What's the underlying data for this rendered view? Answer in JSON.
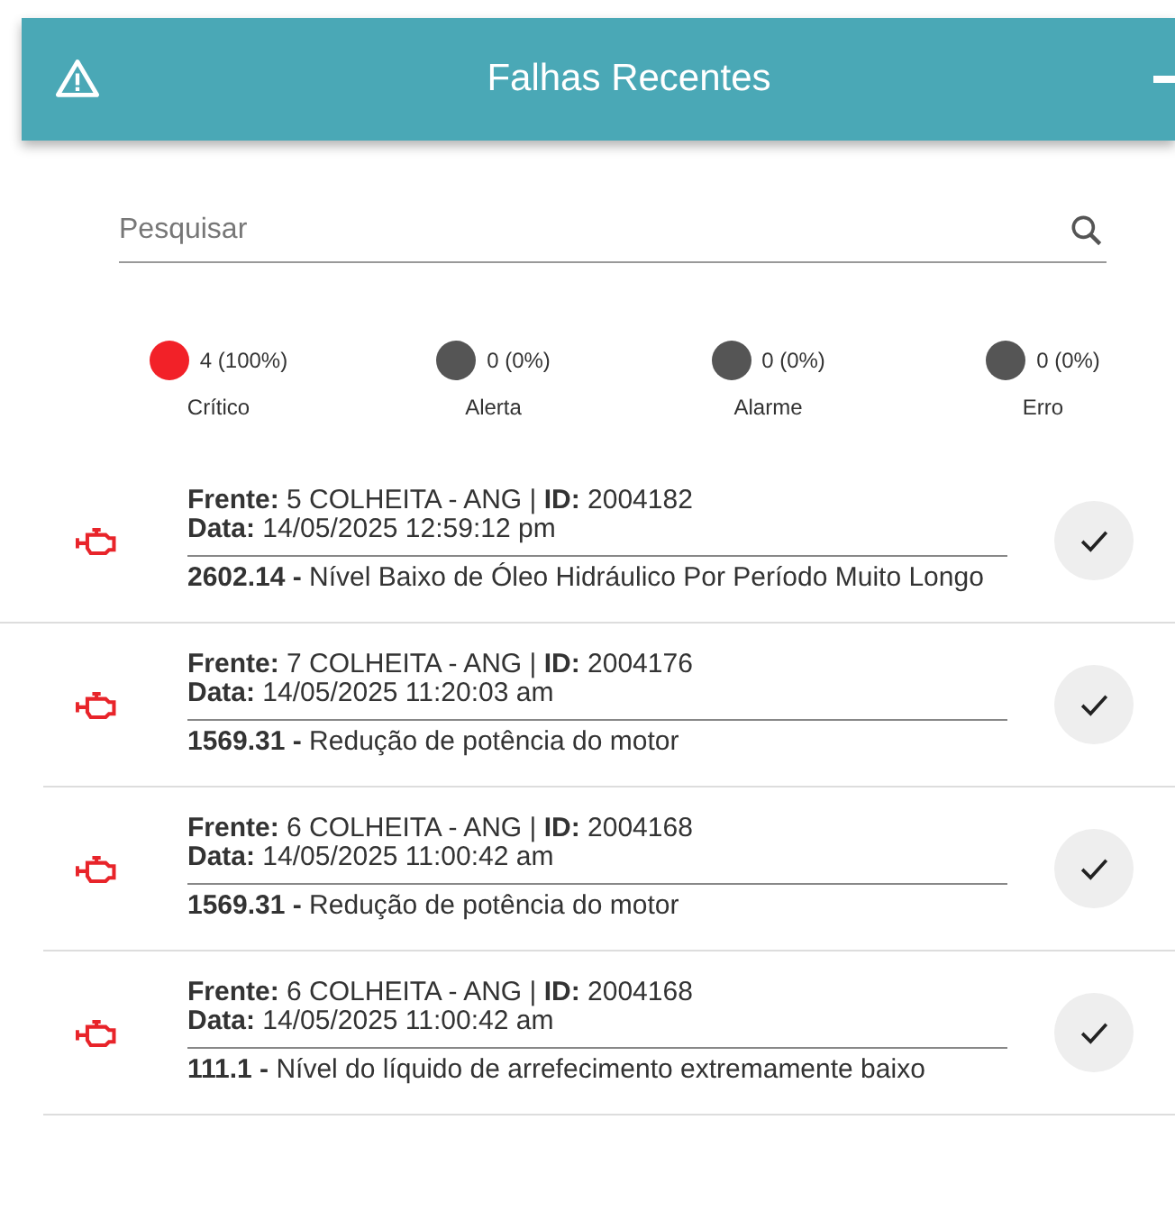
{
  "header": {
    "title": "Falhas Recentes"
  },
  "search": {
    "placeholder": "Pesquisar"
  },
  "legend": [
    {
      "count": "4 (100%)",
      "label": "Crítico",
      "color": "#f22128"
    },
    {
      "count": "0 (0%)",
      "label": "Alerta",
      "color": "#555555"
    },
    {
      "count": "0 (0%)",
      "label": "Alarme",
      "color": "#555555"
    },
    {
      "count": "0 (0%)",
      "label": "Erro",
      "color": "#555555"
    }
  ],
  "faults": [
    {
      "front": "**Frente:** 5 COLHEITA - ANG | **ID:** 2004182",
      "date": "**Data:** 14/05/2025 12:59:12 pm",
      "description": "**2602.14 -** Nível Baixo de Óleo Hidráulico Por Período Muito Longo"
    },
    {
      "front": "**Frente:** 7 COLHEITA - ANG | **ID:** 2004176",
      "date": "**Data:** 14/05/2025 11:20:03 am",
      "description": "**1569.31 -** Redução de potência do motor"
    },
    {
      "front": "**Frente:** 6 COLHEITA - ANG | **ID:** 2004168",
      "date": "**Data:** 14/05/2025 11:00:42 am",
      "description": "**1569.31 -** Redução de potência do motor"
    },
    {
      "front": "**Frente:** 6 COLHEITA - ANG | **ID:** 2004168",
      "date": "**Data:** 14/05/2025 11:00:42 am",
      "description": "**111.1 -** Nível do líquido de arrefecimento extremamente baixo"
    }
  ]
}
